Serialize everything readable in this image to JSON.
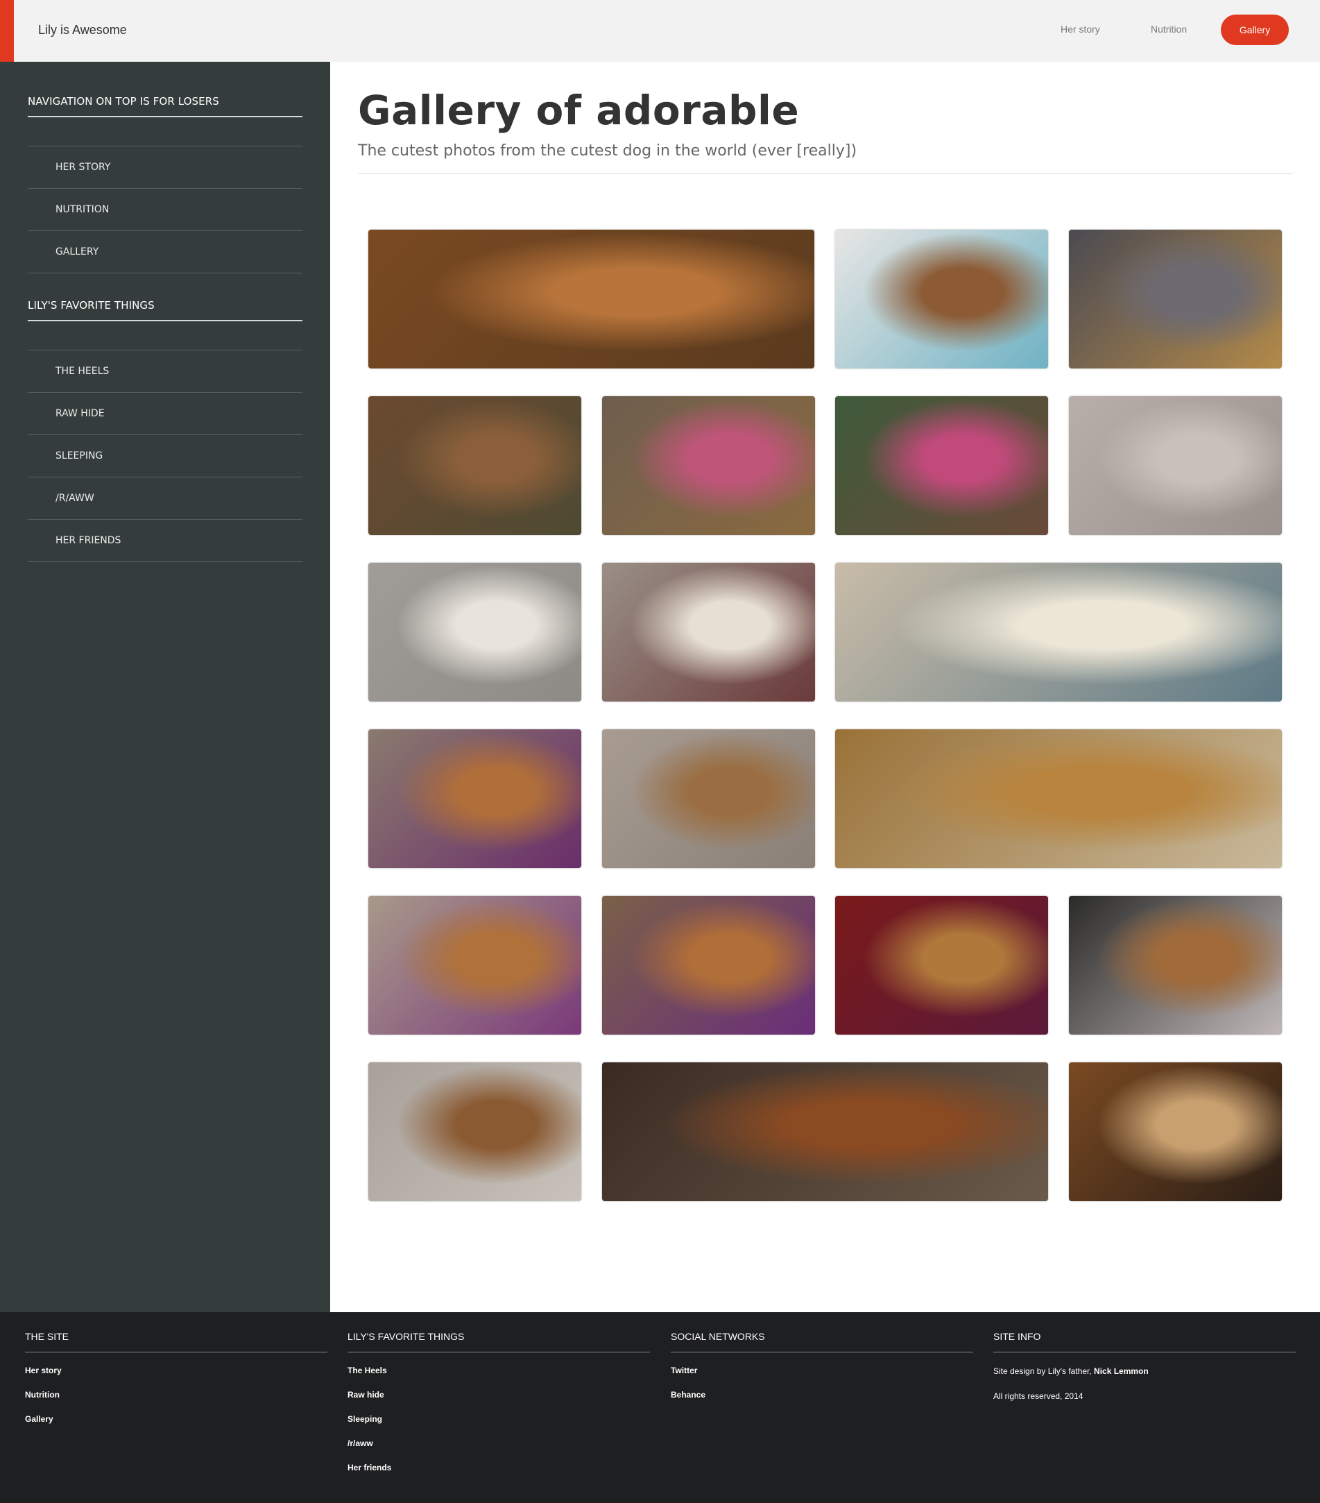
{
  "header": {
    "brand": "Lily is Awesome",
    "nav": [
      {
        "label": "Her story"
      },
      {
        "label": "Nutrition"
      },
      {
        "label": "Gallery"
      }
    ],
    "accent_color": "#e0391f"
  },
  "sidebar": {
    "section1_title": "Navigation on top is for losers",
    "section1_items": [
      {
        "label": "Her story"
      },
      {
        "label": "Nutrition"
      },
      {
        "label": "Gallery"
      }
    ],
    "section2_title": "Lily's favorite things",
    "section2_items": [
      {
        "label": "The Heels"
      },
      {
        "label": "Raw hide"
      },
      {
        "label": "Sleeping"
      },
      {
        "label": "/r/aww"
      },
      {
        "label": "Her friends"
      }
    ]
  },
  "main": {
    "title": "Gallery of adorable",
    "subtitle": "The cutest photos from the cutest dog in the world (ever [really])"
  },
  "gallery": [
    {
      "name": "dog-closeup-glowing-eyes",
      "colors": [
        "#7a4a22",
        "#b8743a",
        "#5a3a1e"
      ]
    },
    {
      "name": "dog-in-car",
      "colors": [
        "#e8e6e4",
        "#8c5a34",
        "#6fb2c4"
      ]
    },
    {
      "name": "dog-sleeping-on-blanket",
      "colors": [
        "#4b4a52",
        "#6d6a72",
        "#b38a4a"
      ]
    },
    {
      "name": "dog-walking-in-leaves",
      "colors": [
        "#6b4a30",
        "#8a5f3a",
        "#4f4a33"
      ]
    },
    {
      "name": "pink-toy-on-couch",
      "colors": [
        "#6e5e4e",
        "#c0557a",
        "#8a6a40"
      ]
    },
    {
      "name": "dog-in-pink-vest",
      "colors": [
        "#3e5a3a",
        "#c04a7a",
        "#6a4a3a"
      ]
    },
    {
      "name": "wooden-deck",
      "colors": [
        "#b8aeaa",
        "#c9c0bc",
        "#9a908c"
      ]
    },
    {
      "name": "rawhide-bone",
      "colors": [
        "#a09c98",
        "#e8e4dc",
        "#8e8a86"
      ]
    },
    {
      "name": "dogs-playing-tug",
      "colors": [
        "#9a9088",
        "#e6dfd2",
        "#6a3a3a"
      ]
    },
    {
      "name": "white-dog-on-carpet",
      "colors": [
        "#c9bca8",
        "#ece6d6",
        "#5e7a86"
      ]
    },
    {
      "name": "puppy-with-toys",
      "colors": [
        "#8a7a6e",
        "#b06e3a",
        "#6a2e6a"
      ]
    },
    {
      "name": "puppy-on-carpet",
      "colors": [
        "#a89c92",
        "#9a6e42",
        "#8a8078"
      ]
    },
    {
      "name": "puppy-purple-harness-closeup",
      "colors": [
        "#9a7238",
        "#b8843e",
        "#c8b89a"
      ]
    },
    {
      "name": "puppy-lying-with-toy",
      "colors": [
        "#a8998a",
        "#b0723a",
        "#7a3a7a"
      ]
    },
    {
      "name": "puppy-looking-up",
      "colors": [
        "#7a6048",
        "#b06e38",
        "#6a2e7a"
      ]
    },
    {
      "name": "puppy-on-red-couch",
      "colors": [
        "#7a1a1a",
        "#b0783a",
        "#5a1a3a"
      ]
    },
    {
      "name": "dog-on-blanket-dark",
      "colors": [
        "#2a2a28",
        "#a06a3a",
        "#c0b8b8"
      ]
    },
    {
      "name": "dog-smiling-on-carpet",
      "colors": [
        "#a8a09a",
        "#8a5a32",
        "#c8c2ba"
      ]
    },
    {
      "name": "dogs-sleeping-dim",
      "colors": [
        "#3a2a22",
        "#8a4a22",
        "#6a5a4a"
      ]
    },
    {
      "name": "dog-on-rug",
      "colors": [
        "#7a4a22",
        "#c8a070",
        "#2a1e16"
      ]
    }
  ],
  "footer": {
    "col1": {
      "title": "The site",
      "links": [
        "Her story",
        "Nutrition",
        "Gallery"
      ]
    },
    "col2": {
      "title": "Lily's favorite things",
      "links": [
        "The Heels",
        "Raw hide",
        "Sleeping",
        "/r/aww",
        "Her friends"
      ]
    },
    "col3": {
      "title": "Social networks",
      "links": [
        "Twitter",
        "Behance"
      ]
    },
    "col4": {
      "title": "Site info",
      "credit_prefix": "Site design by Lily's father,",
      "credit_name": "Nick Lemmon",
      "rights": "All rights reserved, 2014"
    }
  }
}
